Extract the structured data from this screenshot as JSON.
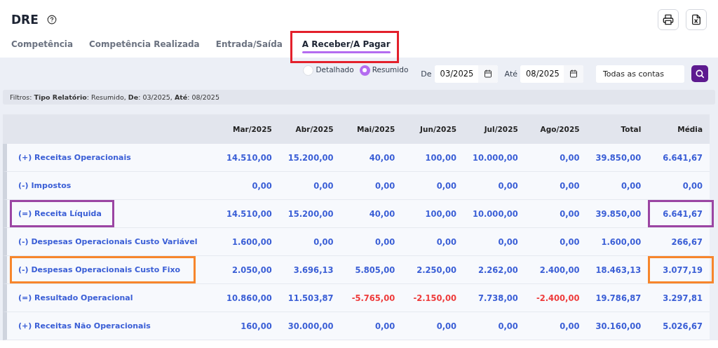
{
  "page": {
    "title": "DRE"
  },
  "tabs": [
    {
      "label": "Competência",
      "selected": false
    },
    {
      "label": "Competência Realizada",
      "selected": false
    },
    {
      "label": "Entrada/Saída",
      "selected": false
    },
    {
      "label": "A Receber/A Pagar",
      "selected": true,
      "color": "#e3202b"
    }
  ],
  "report_type": [
    {
      "label": "Detalhado",
      "selected": false
    },
    {
      "label": "Resumido",
      "selected": true
    }
  ],
  "date_from": {
    "label": "De",
    "value": "03/2025"
  },
  "date_to": {
    "label": "Até",
    "value": "08/2025"
  },
  "account_field": {
    "value": "Todas as contas"
  },
  "filters": "Filtros: **Tipo Relatório**: Resumido, **De**: 03/2025, **Até**: 08/2025",
  "table": {
    "columns": [
      "",
      "Mar/2025",
      "Abr/2025",
      "Mai/2025",
      "Jun/2025",
      "Jul/2025",
      "Ago/2025",
      "Total",
      "Média"
    ],
    "rows": [
      {
        "label": "(+) Receitas Operacionais",
        "values": [
          "14.510,00",
          "15.200,00",
          "40,00",
          "100,00",
          "10.000,00",
          "0,00",
          "39.850,00",
          "6.641,67"
        ],
        "negative": [
          false,
          false,
          false,
          false,
          false,
          false,
          false,
          false
        ]
      },
      {
        "label": "(-) Impostos",
        "values": [
          "0,00",
          "0,00",
          "0,00",
          "0,00",
          "0,00",
          "0,00",
          "0,00",
          "0,00"
        ],
        "negative": [
          false,
          false,
          false,
          false,
          false,
          false,
          false,
          false
        ]
      },
      {
        "label": "(=) Receita Líquida",
        "values": [
          "14.510,00",
          "15.200,00",
          "40,00",
          "100,00",
          "10.000,00",
          "0,00",
          "39.850,00",
          "6.641,67"
        ],
        "negative": [
          false,
          false,
          false,
          false,
          false,
          false,
          false,
          false
        ],
        "color": "#9b45a3"
      },
      {
        "label": "(-) Despesas Operacionais Custo Variável",
        "values": [
          "1.600,00",
          "0,00",
          "0,00",
          "0,00",
          "0,00",
          "0,00",
          "1.600,00",
          "266,67"
        ],
        "negative": [
          false,
          false,
          false,
          false,
          false,
          false,
          false,
          false
        ]
      },
      {
        "label": "(-) Despesas Operacionais Custo Fixo",
        "values": [
          "2.050,00",
          "3.696,13",
          "5.805,00",
          "2.250,00",
          "2.262,00",
          "2.400,00",
          "18.463,13",
          "3.077,19"
        ],
        "negative": [
          false,
          false,
          false,
          false,
          false,
          false,
          false,
          false
        ],
        "color": "#f7862c"
      },
      {
        "label": "(=) Resultado Operacional",
        "values": [
          "10.860,00",
          "11.503,87",
          "-5.765,00",
          "-2.150,00",
          "7.738,00",
          "-2.400,00",
          "19.786,87",
          "3.297,81"
        ],
        "negative": [
          false,
          false,
          true,
          true,
          false,
          true,
          false,
          false
        ]
      },
      {
        "label": "(+) Receitas Não Operacionais",
        "values": [
          "160,00",
          "30.000,00",
          "0,00",
          "0,00",
          "0,00",
          "0,00",
          "30.160,00",
          "5.026,67"
        ],
        "negative": [
          false,
          false,
          false,
          false,
          false,
          false,
          false,
          false
        ]
      }
    ]
  }
}
